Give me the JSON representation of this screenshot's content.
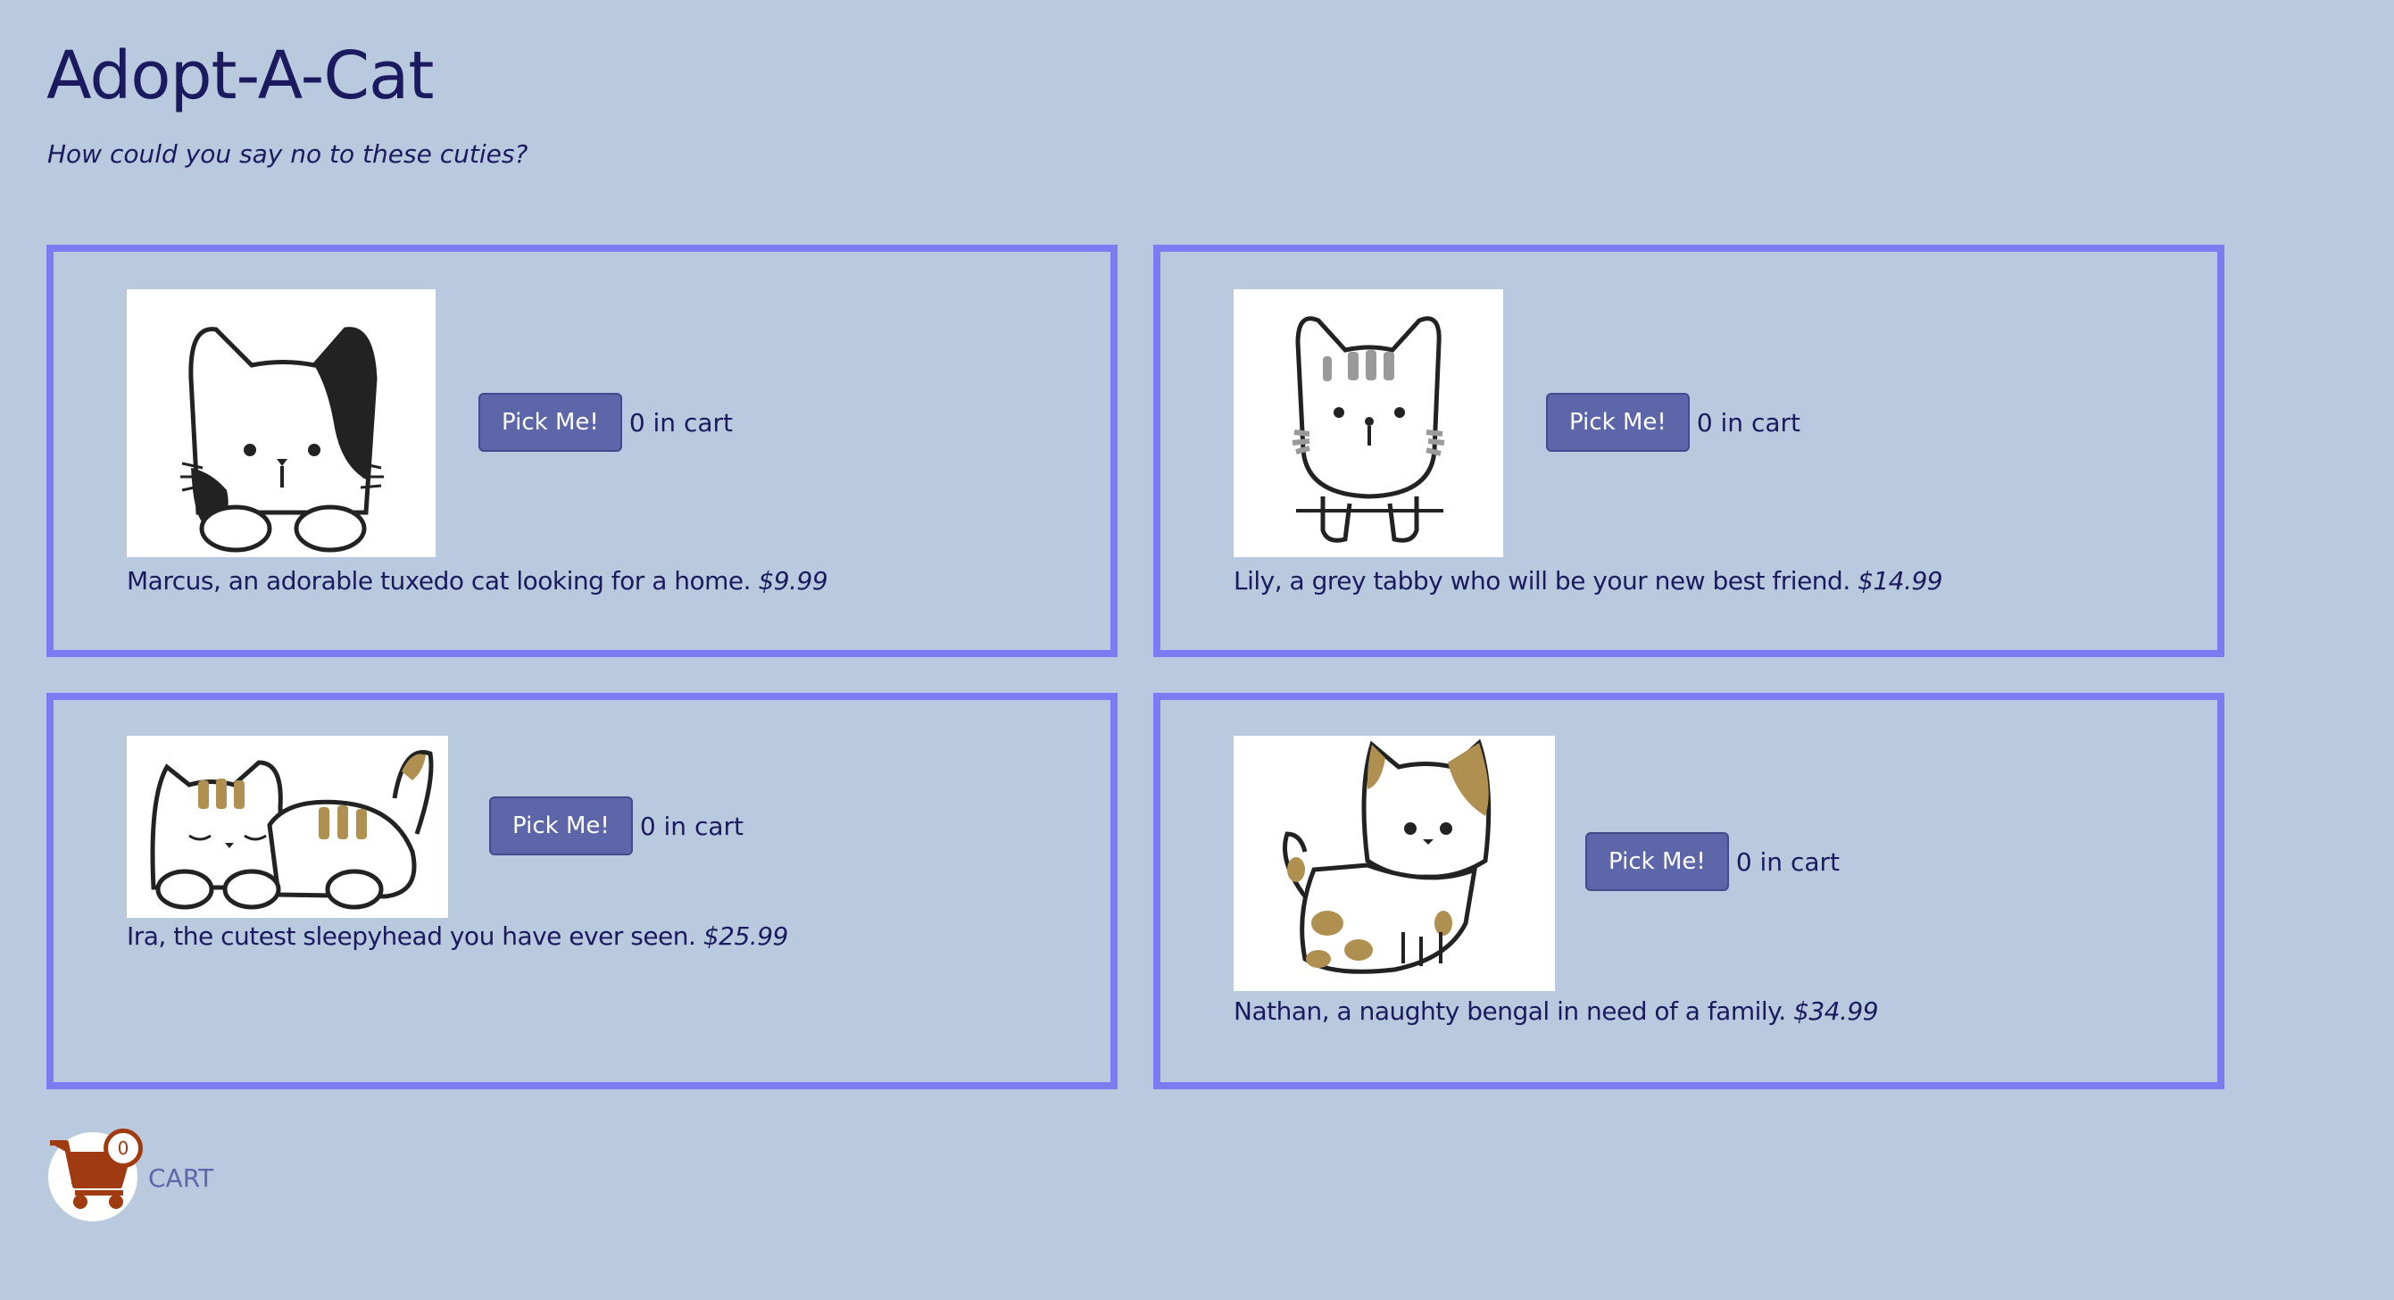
{
  "header": {
    "title": "Adopt-A-Cat",
    "subtitle": "How could you say no to these cuties?"
  },
  "cats": [
    {
      "name_desc": "Marcus, an adorable tuxedo cat looking for a home.",
      "price": "$9.99",
      "button_label": "Pick Me!",
      "cart_text": "0 in cart",
      "image_icon": "tuxedo-cat-icon"
    },
    {
      "name_desc": "Lily, a grey tabby who will be your new best friend.",
      "price": "$14.99",
      "button_label": "Pick Me!",
      "cart_text": "0 in cart",
      "image_icon": "grey-tabby-cat-icon"
    },
    {
      "name_desc": "Ira, the cutest sleepyhead you have ever seen.",
      "price": "$25.99",
      "button_label": "Pick Me!",
      "cart_text": "0 in cart",
      "image_icon": "sleeping-cat-icon"
    },
    {
      "name_desc": "Nathan, a naughty bengal in need of a family.",
      "price": "$34.99",
      "button_label": "Pick Me!",
      "cart_text": "0 in cart",
      "image_icon": "bengal-cat-icon"
    }
  ],
  "cart": {
    "label": "CART",
    "count": "0",
    "icon": "shopping-cart-icon"
  },
  "colors": {
    "background": "#b9cadf",
    "card_border": "#7a7cef",
    "button": "#5d66a8",
    "text": "#1c1a5e",
    "cart_icon": "#a03a10"
  }
}
